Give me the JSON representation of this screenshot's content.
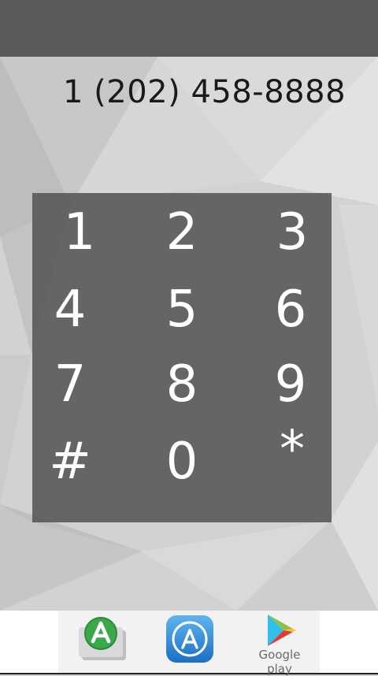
{
  "dialer": {
    "number": "1 (202) 458-8888",
    "keys": [
      "1",
      "2",
      "3",
      "4",
      "5",
      "6",
      "7",
      "8",
      "9",
      "#",
      "0",
      "*"
    ]
  },
  "store_badges": {
    "google_play_label": "Google play",
    "icons": [
      "green-app-store-icon",
      "apple-app-store-icon",
      "google-play-icon"
    ]
  },
  "colors": {
    "topbar": "#4a4a4a",
    "keypad": "#5a5a5a",
    "number_text": "#1a1a1a",
    "key_text": "#ffffff"
  }
}
